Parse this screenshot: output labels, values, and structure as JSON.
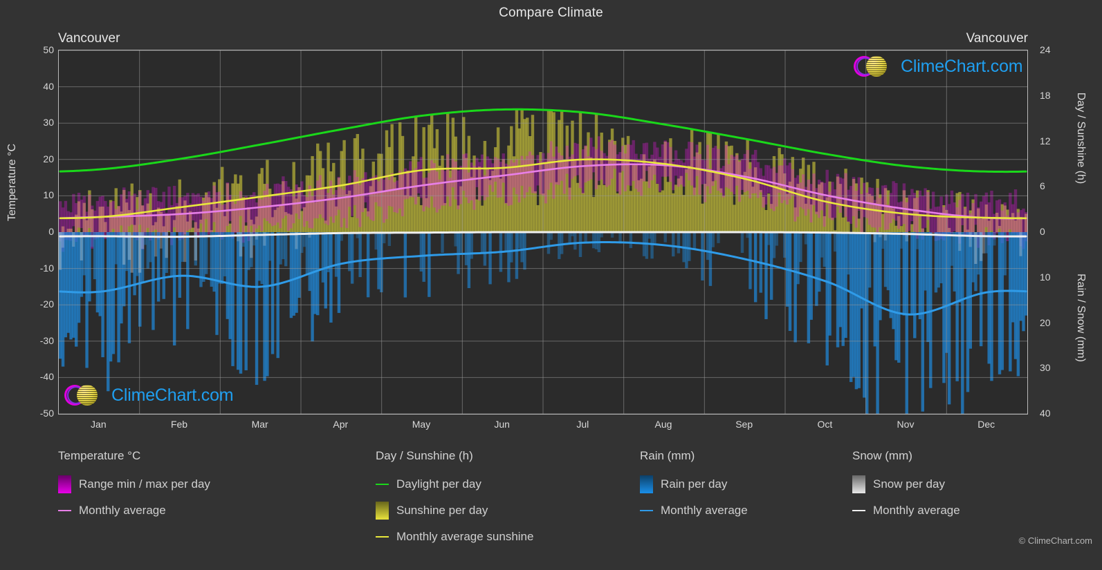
{
  "header": {
    "title": "Compare Climate",
    "city_left": "Vancouver",
    "city_right": "Vancouver"
  },
  "logo": {
    "word": "ClimeChart.com",
    "copyright": "© ClimeChart.com"
  },
  "axes": {
    "left_label": "Temperature °C",
    "right_label_top": "Day / Sunshine (h)",
    "right_label_bottom": "Rain / Snow (mm)",
    "left_ticks": [
      "50",
      "40",
      "30",
      "20",
      "10",
      "0",
      "-10",
      "-20",
      "-30",
      "-40",
      "-50"
    ],
    "right_ticks_top": [
      "24",
      "18",
      "12",
      "6",
      "0"
    ],
    "right_ticks_bottom": [
      "10",
      "20",
      "30",
      "40"
    ],
    "x_ticks": [
      "Jan",
      "Feb",
      "Mar",
      "Apr",
      "May",
      "Jun",
      "Jul",
      "Aug",
      "Sep",
      "Oct",
      "Nov",
      "Dec"
    ]
  },
  "legend": {
    "groups": [
      {
        "title": "Temperature °C",
        "items": [
          {
            "label": "Range min / max per day",
            "type": "box",
            "color": "#e800e8"
          },
          {
            "label": "Monthly average",
            "type": "line",
            "color": "#e87fe8"
          }
        ]
      },
      {
        "title": "Day / Sunshine (h)",
        "items": [
          {
            "label": "Daylight per day",
            "type": "line",
            "color": "#1ad81a"
          },
          {
            "label": "Sunshine per day",
            "type": "box",
            "color": "#e8e23c"
          },
          {
            "label": "Monthly average sunshine",
            "type": "line",
            "color": "#e8e83c"
          }
        ]
      },
      {
        "title": "Rain (mm)",
        "items": [
          {
            "label": "Rain per day",
            "type": "box",
            "color": "#1a8fe8"
          },
          {
            "label": "Monthly average",
            "type": "line",
            "color": "#2f9be8"
          }
        ]
      },
      {
        "title": "Snow (mm)",
        "items": [
          {
            "label": "Snow per day",
            "type": "box",
            "color": "#e8e8e8"
          },
          {
            "label": "Monthly average",
            "type": "line",
            "color": "#f0f0f0"
          }
        ]
      }
    ]
  },
  "chart_data": {
    "type": "line",
    "title": "Compare Climate",
    "subtitle": "Vancouver",
    "xlabel": "",
    "ylabel": "Temperature °C",
    "grid": true,
    "legend_position": "below",
    "categories": [
      "Jan",
      "Feb",
      "Mar",
      "Apr",
      "May",
      "Jun",
      "Jul",
      "Aug",
      "Sep",
      "Oct",
      "Nov",
      "Dec"
    ],
    "axes": {
      "temperature_c": {
        "min": -50,
        "max": 50,
        "step": 10
      },
      "day_sunshine_h": {
        "min": 0,
        "max": 24,
        "step": 6
      },
      "rain_snow_mm": {
        "min": 0,
        "max": 40,
        "step": 10
      }
    },
    "series": [
      {
        "name": "Daylight per day",
        "unit": "h",
        "axis": "day_sunshine_h",
        "color": "#1ad81a",
        "values": [
          8.3,
          9.7,
          11.6,
          13.6,
          15.4,
          16.2,
          15.8,
          14.2,
          12.3,
          10.3,
          8.7,
          8.0
        ]
      },
      {
        "name": "Monthly average sunshine",
        "unit": "h",
        "axis": "day_sunshine_h",
        "color": "#e8e83c",
        "values": [
          2.0,
          3.3,
          4.7,
          6.2,
          8.2,
          8.5,
          9.6,
          9.0,
          7.0,
          4.0,
          2.4,
          1.9
        ]
      },
      {
        "name": "Monthly average temperature",
        "unit": "°C",
        "axis": "temperature_c",
        "color": "#e87fe8",
        "values": [
          4.2,
          5.0,
          6.9,
          9.5,
          12.9,
          15.6,
          18.2,
          18.4,
          15.2,
          10.1,
          6.3,
          3.9
        ]
      },
      {
        "name": "Monthly average rain",
        "unit": "mm",
        "axis": "rain_snow_mm",
        "color": "#2f9be8",
        "values": [
          13.1,
          9.6,
          12.0,
          6.9,
          5.2,
          4.3,
          2.3,
          2.9,
          6.0,
          10.9,
          18.1,
          13.2
        ]
      },
      {
        "name": "Monthly average snow",
        "unit": "mm",
        "axis": "rain_snow_mm",
        "color": "#f0f0f0",
        "values": [
          0.9,
          1.0,
          0.6,
          0.2,
          0.1,
          0.0,
          0.0,
          0.0,
          0.0,
          0.1,
          0.4,
          0.9
        ]
      }
    ],
    "daily_bands": [
      {
        "name": "Range min / max per day",
        "color": "#e800e8",
        "axis": "temperature_c"
      },
      {
        "name": "Sunshine per day",
        "color": "#e8e23c",
        "axis": "day_sunshine_h"
      },
      {
        "name": "Rain per day",
        "color": "#1a8fe8",
        "axis": "rain_snow_mm"
      },
      {
        "name": "Snow per day",
        "color": "#e8e8e8",
        "axis": "rain_snow_mm"
      }
    ]
  }
}
